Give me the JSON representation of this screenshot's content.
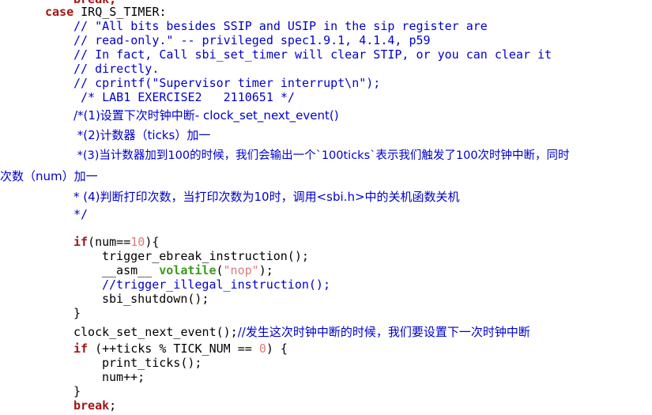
{
  "code": {
    "line_top_partial": "break;",
    "case_kw": "case",
    "case_label": "IRQ_S_TIMER:",
    "c1": "// \"All bits besides SSIP and USIP in the sip register are",
    "c2": "// read-only.\" -- privileged spec1.9.1, 4.1.4, p59",
    "c3": "// In fact, Call sbi_set_timer will clear STIP, or you can clear it",
    "c4": "// directly.",
    "c5": "// cprintf(\"Supervisor timer interrupt\\n\");",
    "c6": " /* LAB1 EXERCISE2   2110651 */",
    "c7": "/*(1)设置下次时钟中断- clock_set_next_event()",
    "c8": " *(2)计数器（ticks）加一",
    "c9": " *(3)当计数器加到100的时候，我们会输出一个`100ticks`表示我们触发了100次时钟中断，同时",
    "c9_wrap": "次数（num）加一",
    "c10": "* (4)判断打印次数，当打印次数为10时，调用<sbi.h>中的关机函数关机",
    "c11": "*/",
    "if1_kw": "if",
    "if1_open": "(num==",
    "if1_num": "10",
    "if1_close": "){",
    "s1": "trigger_ebreak_instruction();",
    "s2_a": "__asm__ ",
    "s2_vol": "volatile",
    "s2_b": "(",
    "s2_str": "\"nop\"",
    "s2_c": ");",
    "s3": "//trigger_illegal_instruction();",
    "s4": "sbi_shutdown();",
    "close1": "}",
    "s5": "clock_set_next_event();",
    "s5_comment": "//发生这次时钟中断的时候，我们要设置下一次时钟中断",
    "if2_kw": "if",
    "if2_a": " (++ticks % TICK_NUM == ",
    "if2_num": "0",
    "if2_b": ") {",
    "s6": "print_ticks();",
    "s7": "num++;",
    "close2": "}",
    "break_kw": "break",
    "break_semi": ";"
  }
}
